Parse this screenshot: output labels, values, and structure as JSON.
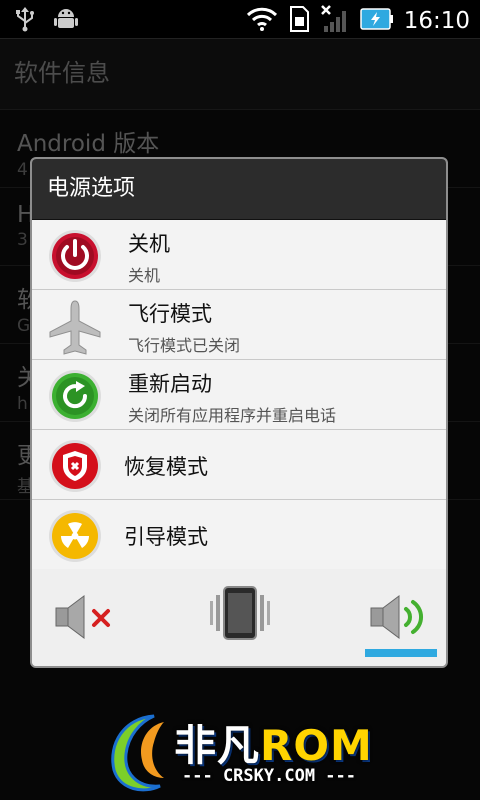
{
  "status_bar": {
    "time": "16:10",
    "icons": [
      "usb-icon",
      "android-debug-icon",
      "wifi-icon",
      "sd-card-icon",
      "signal-off-icon",
      "battery-charging-icon"
    ]
  },
  "background": {
    "header": "软件信息",
    "rows": [
      {
        "title": "Android 版本",
        "subtitle": "4"
      },
      {
        "title": "H",
        "subtitle": "3"
      },
      {
        "title": "软",
        "subtitle": "G"
      },
      {
        "title": "关",
        "subtitle": "h"
      },
      {
        "title": "更",
        "subtitle": "基"
      }
    ]
  },
  "dialog": {
    "title": "电源选项",
    "items": [
      {
        "label": "关机",
        "sub": "关机",
        "icon": "power-icon",
        "color": "#c8102e"
      },
      {
        "label": "飞行模式",
        "sub": "飞行模式已关闭",
        "icon": "airplane-icon",
        "color": "#b8b8b8"
      },
      {
        "label": "重新启动",
        "sub": "关闭所有应用程序并重启电话",
        "icon": "restart-icon",
        "color": "#3cb031"
      },
      {
        "label": "恢复模式",
        "sub": "",
        "icon": "shield-icon",
        "color": "#d40f1a"
      },
      {
        "label": "引导模式",
        "sub": "",
        "icon": "radiation-icon",
        "color": "#f5b800"
      }
    ],
    "sound_modes": [
      "mute-icon",
      "vibrate-icon",
      "sound-on-icon"
    ],
    "selected_sound_mode": "sound-on-icon",
    "accent": "#2fa9e0"
  },
  "watermark": {
    "brand_cn": "非凡",
    "brand_en": "ROM",
    "site": "--- CRSKY.COM ---"
  }
}
